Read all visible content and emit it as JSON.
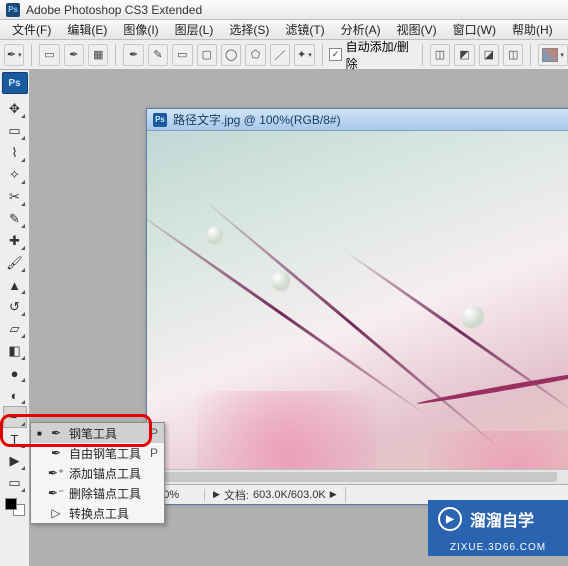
{
  "app": {
    "title": "Adobe Photoshop CS3 Extended",
    "badge": "Ps"
  },
  "menu": {
    "file": "文件(F)",
    "edit": "编辑(E)",
    "image": "图像(I)",
    "layer": "图层(L)",
    "select": "选择(S)",
    "filter": "滤镜(T)",
    "analysis": "分析(A)",
    "view": "视图(V)",
    "window": "窗口(W)",
    "help": "帮助(H)"
  },
  "options": {
    "auto_add_delete_checked": "✓",
    "auto_add_delete_label": "自动添加/删除"
  },
  "document": {
    "title": "路径文字.jpg @ 100%(RGB/8#)",
    "zoom": "100%",
    "doc_label": "文档:",
    "doc_size": "603.0K/603.0K"
  },
  "flyout": {
    "items": [
      {
        "marker": "■",
        "icon": "✒",
        "label": "钢笔工具",
        "shortcut": "P"
      },
      {
        "marker": "",
        "icon": "✒",
        "label": "自由钢笔工具",
        "shortcut": "P"
      },
      {
        "marker": "",
        "icon": "✒⁺",
        "label": "添加锚点工具",
        "shortcut": ""
      },
      {
        "marker": "",
        "icon": "✒⁻",
        "label": "删除锚点工具",
        "shortcut": ""
      },
      {
        "marker": "",
        "icon": "▷",
        "label": "转换点工具",
        "shortcut": ""
      }
    ]
  },
  "watermark": {
    "text": "溜溜自学",
    "sub": "ZIXUE.3D66.COM"
  }
}
